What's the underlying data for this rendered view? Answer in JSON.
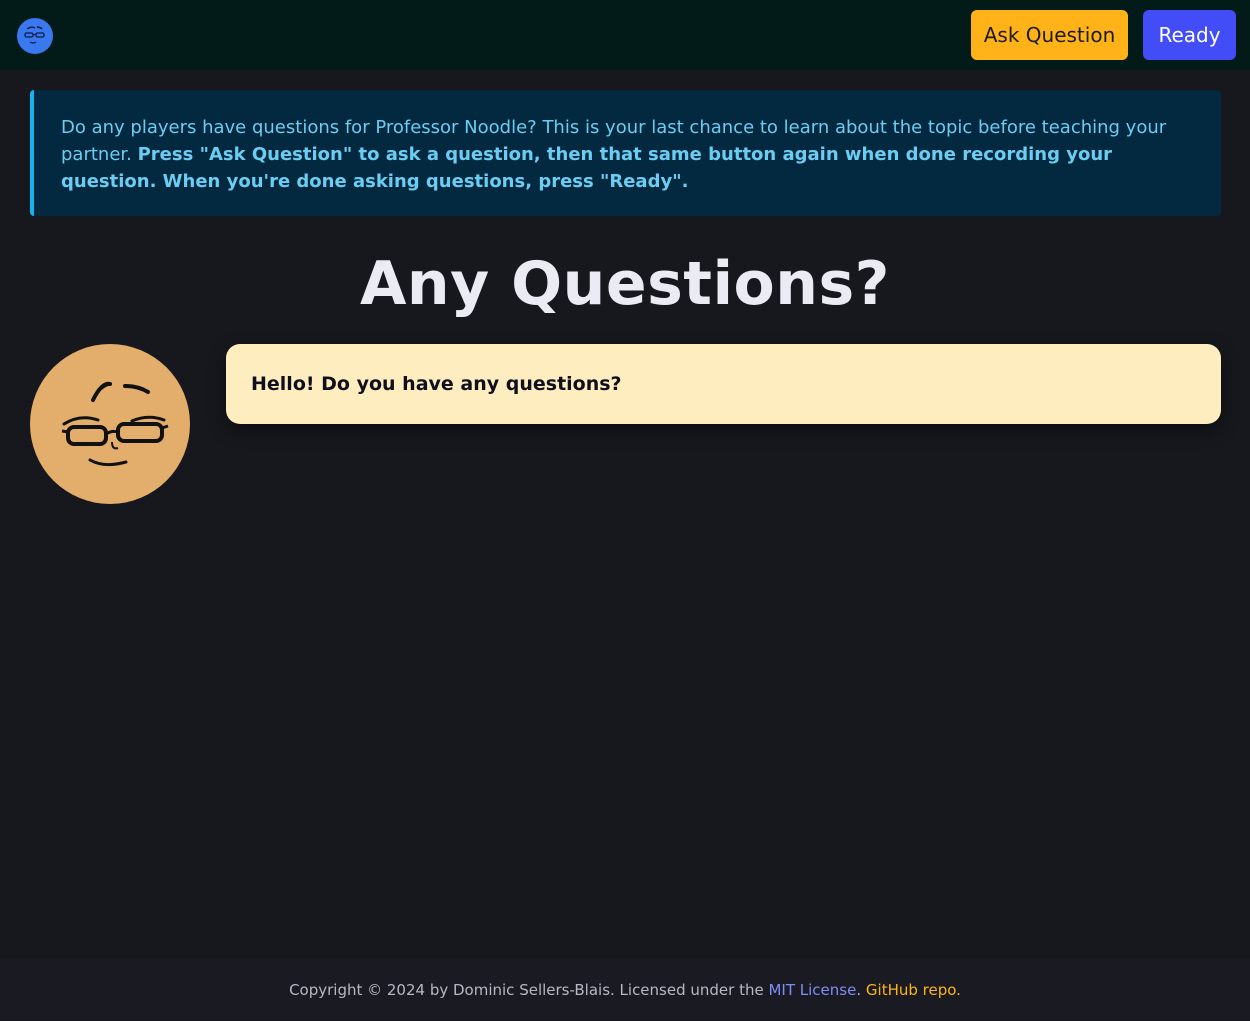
{
  "nav": {
    "ask_label": "Ask Question",
    "ready_label": "Ready"
  },
  "alert": {
    "text": "Do any players have questions for Professor Noodle? This is your last chance to learn about the topic before teaching your partner.",
    "bold_text": "Press \"Ask Question\" to ask a question, then that same button again when done recording your question. When you're done asking questions, press \"Ready\"."
  },
  "main": {
    "title": "Any Questions?",
    "speech": "Hello! Do you have any questions?"
  },
  "footer": {
    "prefix": "Copyright © 2024 by Dominic Sellers-Blais. Licensed under the",
    "mit_link": "MIT License",
    "separator": ".",
    "github_link": "GitHub repo."
  },
  "colors": {
    "nav_bg": "#021a18",
    "ask_button": "#ffb319",
    "ready_button": "#424cf7",
    "alert_bg": "#032940",
    "alert_border": "#16b3ed",
    "avatar_skin": "#e3ad6b",
    "bubble_bg": "#feedbf",
    "page_bg": "#17181d"
  },
  "icons": {
    "logo": "professor-face-icon",
    "avatar": "professor-noodle-face"
  }
}
